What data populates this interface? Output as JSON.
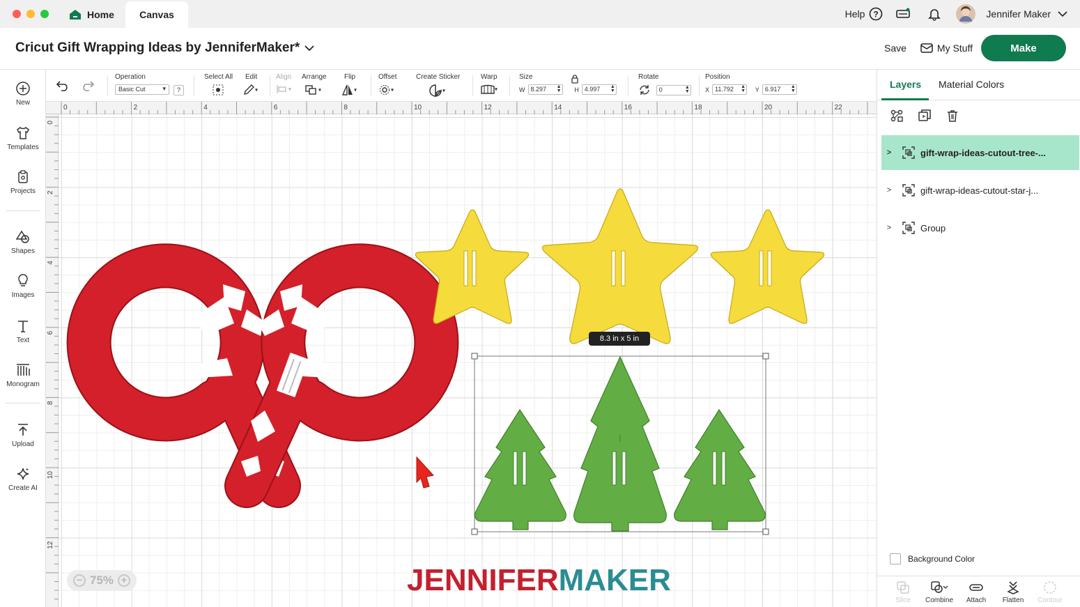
{
  "window": {
    "tabs": [
      {
        "label": "Home",
        "icon": "home-icon"
      },
      {
        "label": "Canvas"
      }
    ],
    "help_label": "Help",
    "user_name": "Jennifer Maker"
  },
  "header": {
    "project_title": "Cricut Gift Wrapping Ideas by JenniferMaker*",
    "save_label": "Save",
    "mystuff_label": "My Stuff",
    "make_label": "Make"
  },
  "rail": {
    "items": [
      {
        "label": "New",
        "icon": "plus-circle-icon"
      },
      {
        "label": "Templates",
        "icon": "shirt-icon"
      },
      {
        "label": "Projects",
        "icon": "clipboard-icon"
      },
      {
        "label": "Shapes",
        "icon": "shapes-icon"
      },
      {
        "label": "Images",
        "icon": "lightbulb-icon"
      },
      {
        "label": "Text",
        "icon": "text-icon"
      },
      {
        "label": "Monogram",
        "icon": "monogram-icon"
      },
      {
        "label": "Upload",
        "icon": "upload-icon"
      },
      {
        "label": "Create AI",
        "icon": "sparkle-icon"
      }
    ]
  },
  "toolbar": {
    "operation_label": "Operation",
    "operation_value": "Basic Cut",
    "help_q": "?",
    "select_all_label": "Select All",
    "edit_label": "Edit",
    "align_label": "Align",
    "arrange_label": "Arrange",
    "flip_label": "Flip",
    "offset_label": "Offset",
    "create_sticker_label": "Create Sticker",
    "warp_label": "Warp",
    "size_label": "Size",
    "w_label": "W",
    "w_value": "8.297",
    "h_label": "H",
    "h_value": "4.997",
    "rotate_label": "Rotate",
    "rotate_value": "0",
    "position_label": "Position",
    "x_label": "X",
    "x_value": "11.792",
    "y_label": "Y",
    "y_value": "6.917"
  },
  "rulers": {
    "top": [
      "0",
      "2",
      "4",
      "6",
      "8",
      "10",
      "12",
      "14",
      "16",
      "18",
      "20",
      "22"
    ],
    "left": [
      "0",
      "2",
      "4",
      "6",
      "8",
      "10",
      "12"
    ]
  },
  "canvas": {
    "size_badge": "8.3  in x 5  in",
    "zoom_value": "75%",
    "watermark_part1": "JENNIFER",
    "watermark_part2": "MAKER",
    "colors": {
      "candy_red": "#d4202a",
      "star_yellow": "#f5dc3c",
      "tree_green": "#62ae45",
      "watermark_red": "#c3202f",
      "watermark_teal": "#2b8c93"
    }
  },
  "panel": {
    "tabs": [
      "Layers",
      "Material Colors"
    ],
    "layers": [
      {
        "name": "gift-wrap-ideas-cutout-tree-...",
        "selected": true
      },
      {
        "name": "gift-wrap-ideas-cutout-star-j...",
        "selected": false
      },
      {
        "name": "Group",
        "selected": false
      }
    ],
    "background_color_label": "Background Color",
    "bottom_actions": [
      {
        "label": "Slice",
        "enabled": false
      },
      {
        "label": "Combine",
        "enabled": true
      },
      {
        "label": "Attach",
        "enabled": true
      },
      {
        "label": "Flatten",
        "enabled": true
      },
      {
        "label": "Contour",
        "enabled": false
      }
    ]
  },
  "theme": {
    "accent": "#107b4e",
    "layer_selected_bg": "#a8e6cc"
  }
}
